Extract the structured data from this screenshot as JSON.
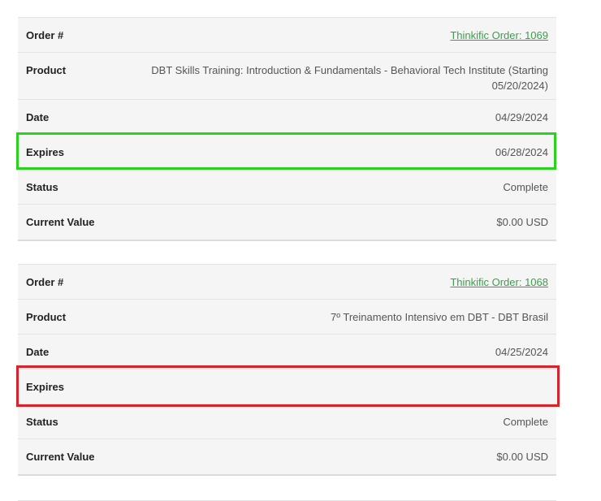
{
  "orders": [
    {
      "order_label": "Order #",
      "order_value": "Thinkific Order: 1069",
      "product_label": "Product",
      "product_value": "DBT Skills Training: Introduction & Fundamentals - Behavioral Tech Institute (Starting 05/20/2024)",
      "date_label": "Date",
      "date_value": "04/29/2024",
      "expires_label": "Expires",
      "expires_value": "06/28/2024",
      "status_label": "Status",
      "status_value": "Complete",
      "current_value_label": "Current Value",
      "current_value": "$0.00 USD"
    },
    {
      "order_label": "Order #",
      "order_value": "Thinkific Order: 1068",
      "product_label": "Product",
      "product_value": "7º Treinamento Intensivo em DBT - DBT Brasil",
      "date_label": "Date",
      "date_value": "04/25/2024",
      "expires_label": "Expires",
      "expires_value": "",
      "status_label": "Status",
      "status_value": "Complete",
      "current_value_label": "Current Value",
      "current_value": "$0.00 USD"
    }
  ],
  "colors": {
    "link": "#3a9e4a",
    "highlight_green": "#2ad11e",
    "highlight_red": "#d9232a"
  }
}
